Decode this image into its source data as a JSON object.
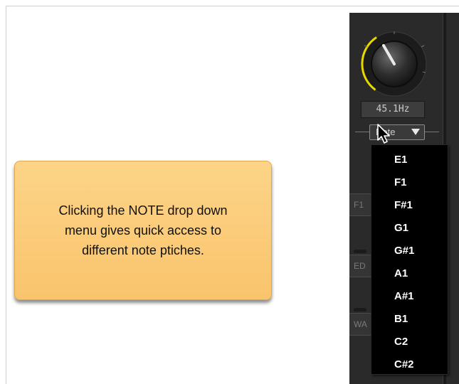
{
  "callout": {
    "text": "Clicking the NOTE drop down\nmenu gives quick access to\ndifferent note ptiches."
  },
  "synth": {
    "frequency_readout": "45.1Hz",
    "knob_level": 0.3,
    "note_button_label": "Note",
    "side_labels": [
      "F1",
      "ED",
      "WA"
    ]
  },
  "note_menu": {
    "items": [
      "E1",
      "F1",
      "F#1",
      "G1",
      "G#1",
      "A1",
      "A#1",
      "B1",
      "C2",
      "C#2"
    ]
  },
  "colors": {
    "callout_fill": "#f9c46c",
    "knob_arc": "#e6d800",
    "menu_background": "#000000",
    "panel_background": "#2a2a2a"
  },
  "icons": [
    "dropdown-arrow-icon",
    "mouse-cursor-icon"
  ]
}
